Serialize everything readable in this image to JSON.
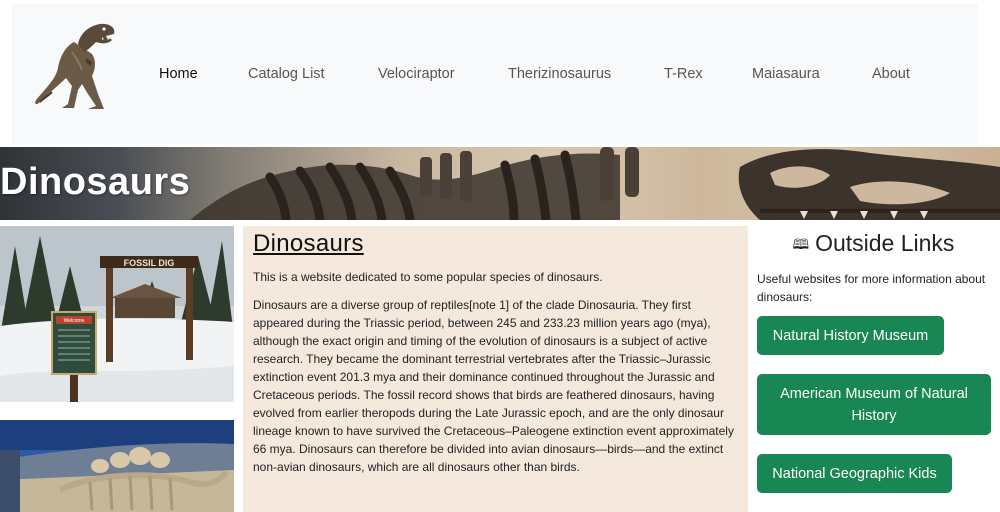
{
  "nav": {
    "items": [
      {
        "label": "Home",
        "active": true
      },
      {
        "label": "Catalog List"
      },
      {
        "label": "Velociraptor"
      },
      {
        "label": "Therizinosaurus"
      },
      {
        "label": "T-Rex"
      },
      {
        "label": "Maiasaura"
      },
      {
        "label": "About"
      }
    ]
  },
  "banner": {
    "title": "Dinosaurs"
  },
  "photos": {
    "photo1_sign": "FOSSIL DIG",
    "photo1_sign2": "Welcome"
  },
  "main": {
    "heading": "Dinosaurs",
    "intro": "This is a website dedicated to some popular species of dinosaurs.",
    "body": "Dinosaurs are a diverse group of reptiles[note 1] of the clade Dinosauria. They first appeared during the Triassic period, between 245 and 233.23 million years ago (mya), although the exact origin and timing of the evolution of dinosaurs is a subject of active research. They became the dominant terrestrial vertebrates after the Triassic–Jurassic extinction event 201.3 mya and their dominance continued throughout the Jurassic and Cretaceous periods. The fossil record shows that birds are feathered dinosaurs, having evolved from earlier theropods during the Late Jurassic epoch, and are the only dinosaur lineage known to have survived the Cretaceous–Paleogene extinction event approximately 66 mya. Dinosaurs can therefore be divided into avian dinosaurs—birds—and the extinct non-avian dinosaurs, which are all dinosaurs other than birds."
  },
  "aside": {
    "icon": "book-icon",
    "heading": "Outside Links",
    "description": "Useful websites for more information about dinosaurs:",
    "links": [
      {
        "label": "Natural History Museum"
      },
      {
        "label": "American Museum of Natural History"
      },
      {
        "label": "National Geographic Kids"
      }
    ]
  },
  "colors": {
    "button": "#198754",
    "content_bg": "#f5e8dc",
    "header_bg": "#f8f9fa"
  }
}
